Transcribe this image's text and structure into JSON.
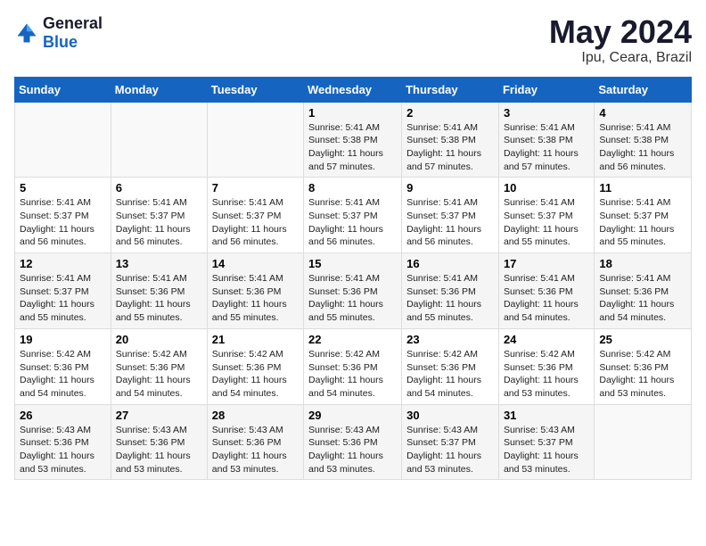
{
  "header": {
    "logo_line1": "General",
    "logo_line2": "Blue",
    "title": "May 2024",
    "subtitle": "Ipu, Ceara, Brazil"
  },
  "days_of_week": [
    "Sunday",
    "Monday",
    "Tuesday",
    "Wednesday",
    "Thursday",
    "Friday",
    "Saturday"
  ],
  "weeks": [
    [
      {
        "day": "",
        "info": ""
      },
      {
        "day": "",
        "info": ""
      },
      {
        "day": "",
        "info": ""
      },
      {
        "day": "1",
        "info": "Sunrise: 5:41 AM\nSunset: 5:38 PM\nDaylight: 11 hours\nand 57 minutes."
      },
      {
        "day": "2",
        "info": "Sunrise: 5:41 AM\nSunset: 5:38 PM\nDaylight: 11 hours\nand 57 minutes."
      },
      {
        "day": "3",
        "info": "Sunrise: 5:41 AM\nSunset: 5:38 PM\nDaylight: 11 hours\nand 57 minutes."
      },
      {
        "day": "4",
        "info": "Sunrise: 5:41 AM\nSunset: 5:38 PM\nDaylight: 11 hours\nand 56 minutes."
      }
    ],
    [
      {
        "day": "5",
        "info": "Sunrise: 5:41 AM\nSunset: 5:37 PM\nDaylight: 11 hours\nand 56 minutes."
      },
      {
        "day": "6",
        "info": "Sunrise: 5:41 AM\nSunset: 5:37 PM\nDaylight: 11 hours\nand 56 minutes."
      },
      {
        "day": "7",
        "info": "Sunrise: 5:41 AM\nSunset: 5:37 PM\nDaylight: 11 hours\nand 56 minutes."
      },
      {
        "day": "8",
        "info": "Sunrise: 5:41 AM\nSunset: 5:37 PM\nDaylight: 11 hours\nand 56 minutes."
      },
      {
        "day": "9",
        "info": "Sunrise: 5:41 AM\nSunset: 5:37 PM\nDaylight: 11 hours\nand 56 minutes."
      },
      {
        "day": "10",
        "info": "Sunrise: 5:41 AM\nSunset: 5:37 PM\nDaylight: 11 hours\nand 55 minutes."
      },
      {
        "day": "11",
        "info": "Sunrise: 5:41 AM\nSunset: 5:37 PM\nDaylight: 11 hours\nand 55 minutes."
      }
    ],
    [
      {
        "day": "12",
        "info": "Sunrise: 5:41 AM\nSunset: 5:37 PM\nDaylight: 11 hours\nand 55 minutes."
      },
      {
        "day": "13",
        "info": "Sunrise: 5:41 AM\nSunset: 5:36 PM\nDaylight: 11 hours\nand 55 minutes."
      },
      {
        "day": "14",
        "info": "Sunrise: 5:41 AM\nSunset: 5:36 PM\nDaylight: 11 hours\nand 55 minutes."
      },
      {
        "day": "15",
        "info": "Sunrise: 5:41 AM\nSunset: 5:36 PM\nDaylight: 11 hours\nand 55 minutes."
      },
      {
        "day": "16",
        "info": "Sunrise: 5:41 AM\nSunset: 5:36 PM\nDaylight: 11 hours\nand 55 minutes."
      },
      {
        "day": "17",
        "info": "Sunrise: 5:41 AM\nSunset: 5:36 PM\nDaylight: 11 hours\nand 54 minutes."
      },
      {
        "day": "18",
        "info": "Sunrise: 5:41 AM\nSunset: 5:36 PM\nDaylight: 11 hours\nand 54 minutes."
      }
    ],
    [
      {
        "day": "19",
        "info": "Sunrise: 5:42 AM\nSunset: 5:36 PM\nDaylight: 11 hours\nand 54 minutes."
      },
      {
        "day": "20",
        "info": "Sunrise: 5:42 AM\nSunset: 5:36 PM\nDaylight: 11 hours\nand 54 minutes."
      },
      {
        "day": "21",
        "info": "Sunrise: 5:42 AM\nSunset: 5:36 PM\nDaylight: 11 hours\nand 54 minutes."
      },
      {
        "day": "22",
        "info": "Sunrise: 5:42 AM\nSunset: 5:36 PM\nDaylight: 11 hours\nand 54 minutes."
      },
      {
        "day": "23",
        "info": "Sunrise: 5:42 AM\nSunset: 5:36 PM\nDaylight: 11 hours\nand 54 minutes."
      },
      {
        "day": "24",
        "info": "Sunrise: 5:42 AM\nSunset: 5:36 PM\nDaylight: 11 hours\nand 53 minutes."
      },
      {
        "day": "25",
        "info": "Sunrise: 5:42 AM\nSunset: 5:36 PM\nDaylight: 11 hours\nand 53 minutes."
      }
    ],
    [
      {
        "day": "26",
        "info": "Sunrise: 5:43 AM\nSunset: 5:36 PM\nDaylight: 11 hours\nand 53 minutes."
      },
      {
        "day": "27",
        "info": "Sunrise: 5:43 AM\nSunset: 5:36 PM\nDaylight: 11 hours\nand 53 minutes."
      },
      {
        "day": "28",
        "info": "Sunrise: 5:43 AM\nSunset: 5:36 PM\nDaylight: 11 hours\nand 53 minutes."
      },
      {
        "day": "29",
        "info": "Sunrise: 5:43 AM\nSunset: 5:36 PM\nDaylight: 11 hours\nand 53 minutes."
      },
      {
        "day": "30",
        "info": "Sunrise: 5:43 AM\nSunset: 5:37 PM\nDaylight: 11 hours\nand 53 minutes."
      },
      {
        "day": "31",
        "info": "Sunrise: 5:43 AM\nSunset: 5:37 PM\nDaylight: 11 hours\nand 53 minutes."
      },
      {
        "day": "",
        "info": ""
      }
    ]
  ]
}
